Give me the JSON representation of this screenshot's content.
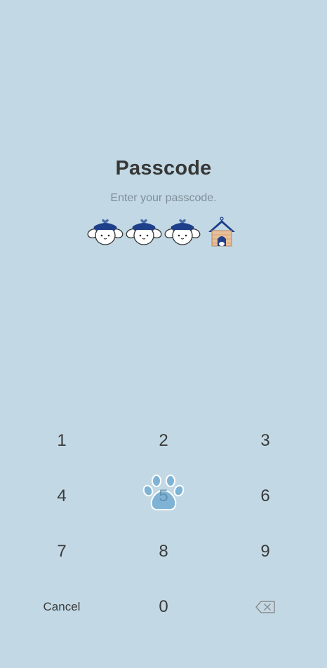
{
  "header": {
    "title": "Passcode",
    "subtitle": "Enter your passcode."
  },
  "passcode_indicators": [
    {
      "state": "filled",
      "icon": "puppy-face-icon"
    },
    {
      "state": "filled",
      "icon": "puppy-face-icon"
    },
    {
      "state": "filled",
      "icon": "puppy-face-icon"
    },
    {
      "state": "empty",
      "icon": "doghouse-icon"
    }
  ],
  "keypad": {
    "keys": [
      "1",
      "2",
      "3",
      "4",
      "5",
      "6",
      "7",
      "8",
      "9",
      "0"
    ],
    "cancel_label": "Cancel",
    "backspace_icon": "backspace-icon",
    "pressed_key_overlay": "paw-print-icon"
  },
  "colors": {
    "background": "#c2d9e5",
    "title": "#373737",
    "subtitle": "#7f8d97",
    "accent_navy": "#1e3f8a",
    "paw": "#7fb3d6"
  }
}
